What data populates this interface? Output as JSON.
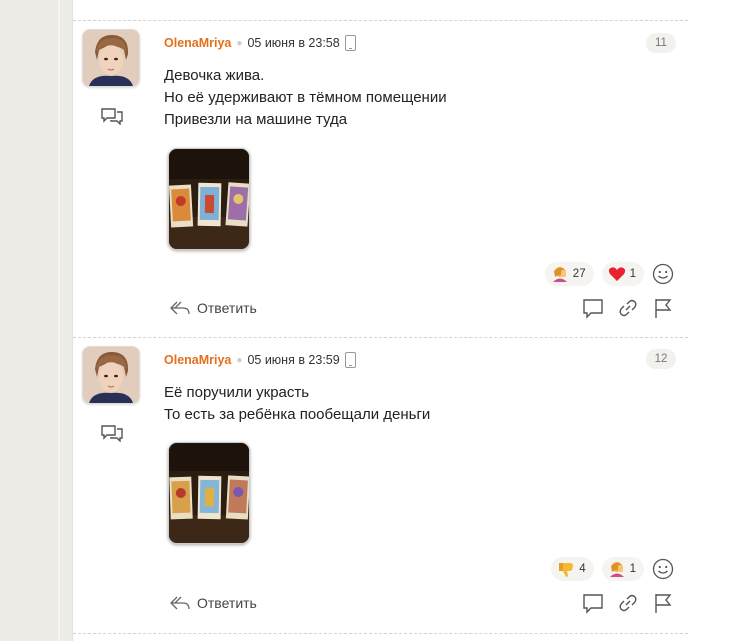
{
  "comments": [
    {
      "author": "OlenaMriya",
      "date": "05 июня в 23:58",
      "number": "11",
      "lines": [
        "Девочка жива.",
        "Но её удерживают в тёмном помещении",
        "Привезли на машине туда"
      ],
      "reactions": [
        {
          "icon": "facepalm-icon",
          "count": "27"
        },
        {
          "icon": "heart-icon",
          "count": "1"
        }
      ],
      "reply_label": "Ответить"
    },
    {
      "author": "OlenaMriya",
      "date": "05 июня в 23:59",
      "number": "12",
      "lines": [
        "Её поручили украсть",
        "То есть за ребёнка пообещали деньги"
      ],
      "reactions": [
        {
          "icon": "thumbs-down-icon",
          "count": "4"
        },
        {
          "icon": "facepalm-icon",
          "count": "1"
        }
      ],
      "reply_label": "Ответить"
    }
  ],
  "colors": {
    "author": "#e5701b",
    "background": "#eeece7",
    "panel": "#ffffff"
  }
}
